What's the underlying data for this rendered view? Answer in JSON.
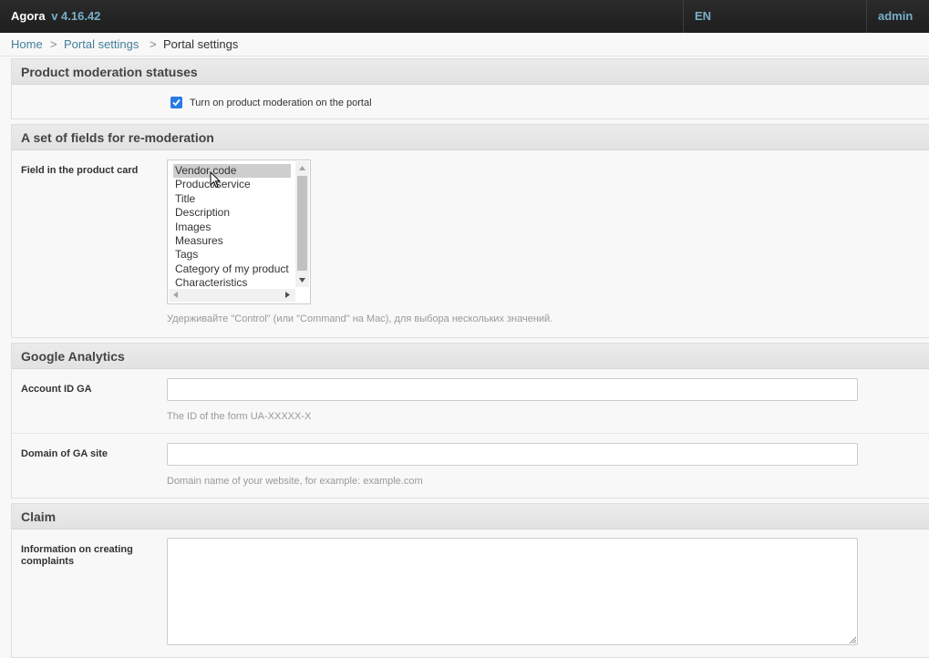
{
  "header": {
    "brand": "Agora",
    "version": "v 4.16.42",
    "language": "EN",
    "user": "admin"
  },
  "breadcrumbs": {
    "home": "Home",
    "sep": ">",
    "section": "Portal settings",
    "current": "Portal settings"
  },
  "moderation": {
    "title": "Product moderation statuses",
    "checkbox_label": "Turn on product moderation on the portal",
    "checked": true
  },
  "remoderation": {
    "title": "A set of fields for re-moderation",
    "field_label": "Field in the product card",
    "options": [
      "Vendor code",
      "Product/service",
      "Title",
      "Description",
      "Images",
      "Measures",
      "Tags",
      "Category of my product",
      "Characteristics"
    ],
    "selected_option": "Vendor code",
    "help": "Удерживайте \"Control\" (или \"Command\" на Mac), для выбора нескольких значений."
  },
  "analytics": {
    "title": "Google Analytics",
    "account_label": "Account ID GA",
    "account_value": "",
    "account_help": "The ID of the form UA-XXXXX-X",
    "domain_label": "Domain of GA site",
    "domain_value": "",
    "domain_help": "Domain name of your website, for example: example.com"
  },
  "claim": {
    "title": "Claim",
    "info_label": "Information on creating complaints",
    "info_value": ""
  },
  "colors": {
    "topbar": "#1e1e1e",
    "link": "#447e9b",
    "header_link": "#79aec8",
    "checkbox": "#2a7ae4"
  }
}
